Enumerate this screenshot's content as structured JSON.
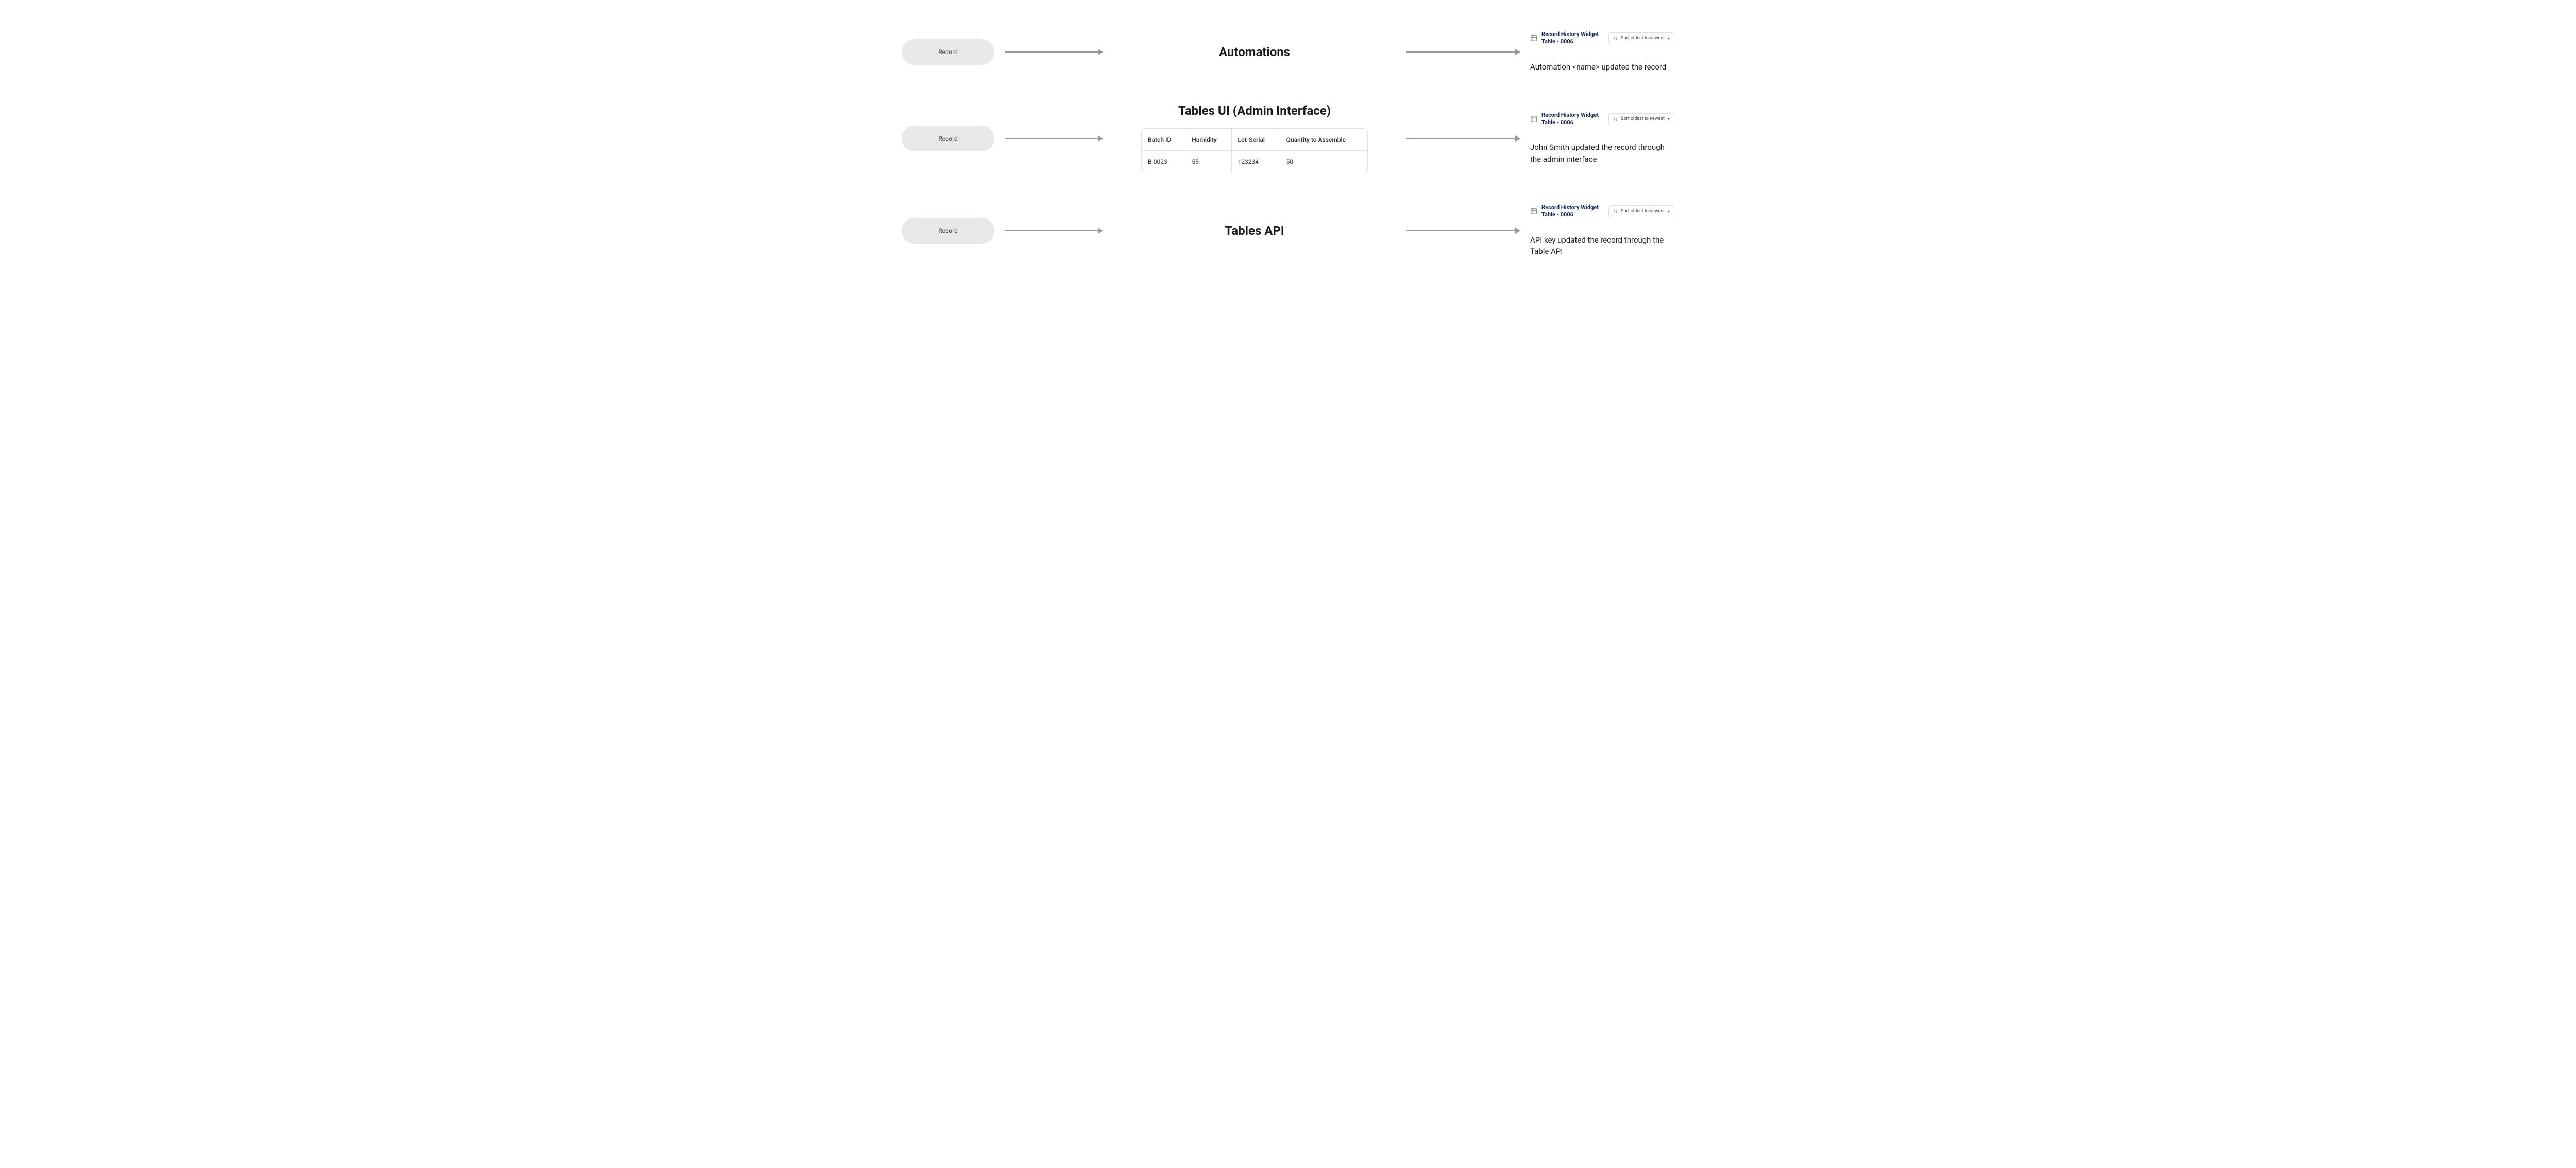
{
  "rows": [
    {
      "record_label": "Record",
      "title": "Automations",
      "widget_title": "Record History Widget Table - 0006",
      "sort_label": "Sort oldest to newest",
      "description": "Automation <name> updated the record"
    },
    {
      "record_label": "Record",
      "title": "Tables UI (Admin Interface)",
      "table": {
        "headers": [
          "Batch ID",
          "Humidity",
          "Lot-Serial",
          "Quantity to Assemble"
        ],
        "row": [
          "B-0023",
          "55",
          "123234",
          "50"
        ]
      },
      "widget_title": "Record History Widget Table - 0006",
      "sort_label": "Sort oldest to newest",
      "description": "John Smith updated the record through the admin interface"
    },
    {
      "record_label": "Record",
      "title": "Tables API",
      "widget_title": "Record History Widget Table - 0006",
      "sort_label": "Sort oldest to newest",
      "description": "API key updated the record through the Table API"
    }
  ]
}
